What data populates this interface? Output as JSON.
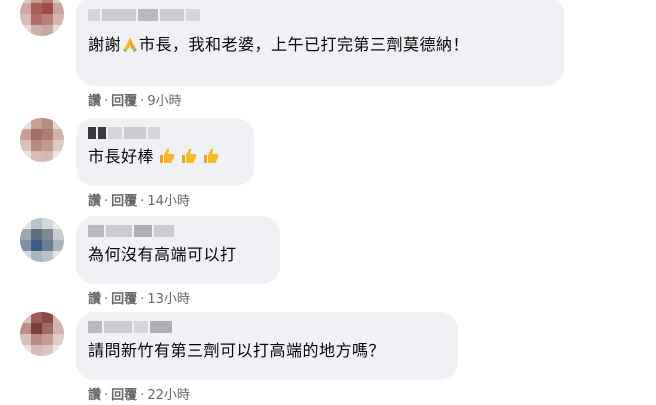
{
  "comments": [
    {
      "text": "謝謝",
      "text_after": "市長，我和老婆，上午已打完第三劑莫德納！",
      "like_label": "讚",
      "reply_label": "回覆",
      "time": "9小時"
    },
    {
      "text": "市長好棒",
      "like_label": "讚",
      "reply_label": "回覆",
      "time": "14小時"
    },
    {
      "text": "為何沒有高端可以打",
      "like_label": "讚",
      "reply_label": "回覆",
      "time": "13小時"
    },
    {
      "text": "請問新竹有第三劑可以打高端的地方嗎？",
      "like_label": "讚",
      "reply_label": "回覆",
      "time": "22小時"
    }
  ],
  "separator": "·",
  "colors": {
    "bubble": "#eff1f4",
    "text": "#050505",
    "meta": "#65676b",
    "emoji": "#f7b928"
  },
  "icons": {
    "pray": "pray-emoji-icon",
    "thumbs_up": "thumbs-up-emoji-icon"
  }
}
